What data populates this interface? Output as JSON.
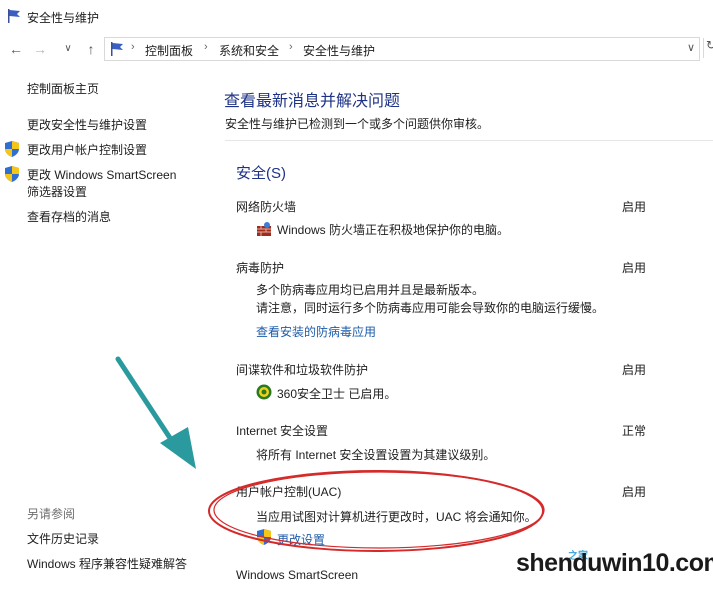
{
  "window": {
    "title": "安全性与维护"
  },
  "address_bar": {
    "crumbs": [
      "控制面板",
      "系统和安全",
      "安全性与维护"
    ]
  },
  "sidebar": {
    "home": "控制面板主页",
    "links": [
      "更改安全性与维护设置",
      "更改用户帐户控制设置",
      "更改 Windows SmartScreen",
      "筛选器设置",
      "查看存档的消息"
    ],
    "see_also_title": "另请参阅",
    "see_also": [
      "文件历史记录",
      "Windows 程序兼容性疑难解答"
    ]
  },
  "main": {
    "title": "查看最新消息并解决问题",
    "subtitle": "安全性与维护已检测到一个或多个问题供你审核。",
    "section_title": "安全(S)",
    "items": [
      {
        "name": "网络防火墙",
        "status": "启用",
        "desc": [
          "Windows 防火墙正在积极地保护你的电脑。"
        ]
      },
      {
        "name": "病毒防护",
        "status": "启用",
        "desc": [
          "多个防病毒应用均已启用并且是最新版本。",
          "请注意，同时运行多个防病毒应用可能会导致你的电脑运行缓慢。"
        ],
        "link": "查看安装的防病毒应用"
      },
      {
        "name": "间谍软件和垃圾软件防护",
        "status": "启用",
        "desc": [
          "360安全卫士 已启用。"
        ]
      },
      {
        "name": "Internet 安全设置",
        "status": "正常",
        "desc": [
          "将所有 Internet 安全设置设置为其建议级别。"
        ]
      },
      {
        "name": "用户帐户控制(UAC)",
        "status": "启用",
        "desc": [
          "当应用试图对计算机进行更改时，UAC 将会通知你。"
        ],
        "link": "更改设置"
      },
      {
        "name": "Windows SmartScreen"
      }
    ]
  },
  "watermark": {
    "text": "shenduwin10.com",
    "sub": "之家"
  },
  "colors": {
    "heading": "#1e3287",
    "link": "#1e5ba8",
    "annotation_red": "#d42a2a",
    "arrow_teal": "#2a9a9e"
  }
}
